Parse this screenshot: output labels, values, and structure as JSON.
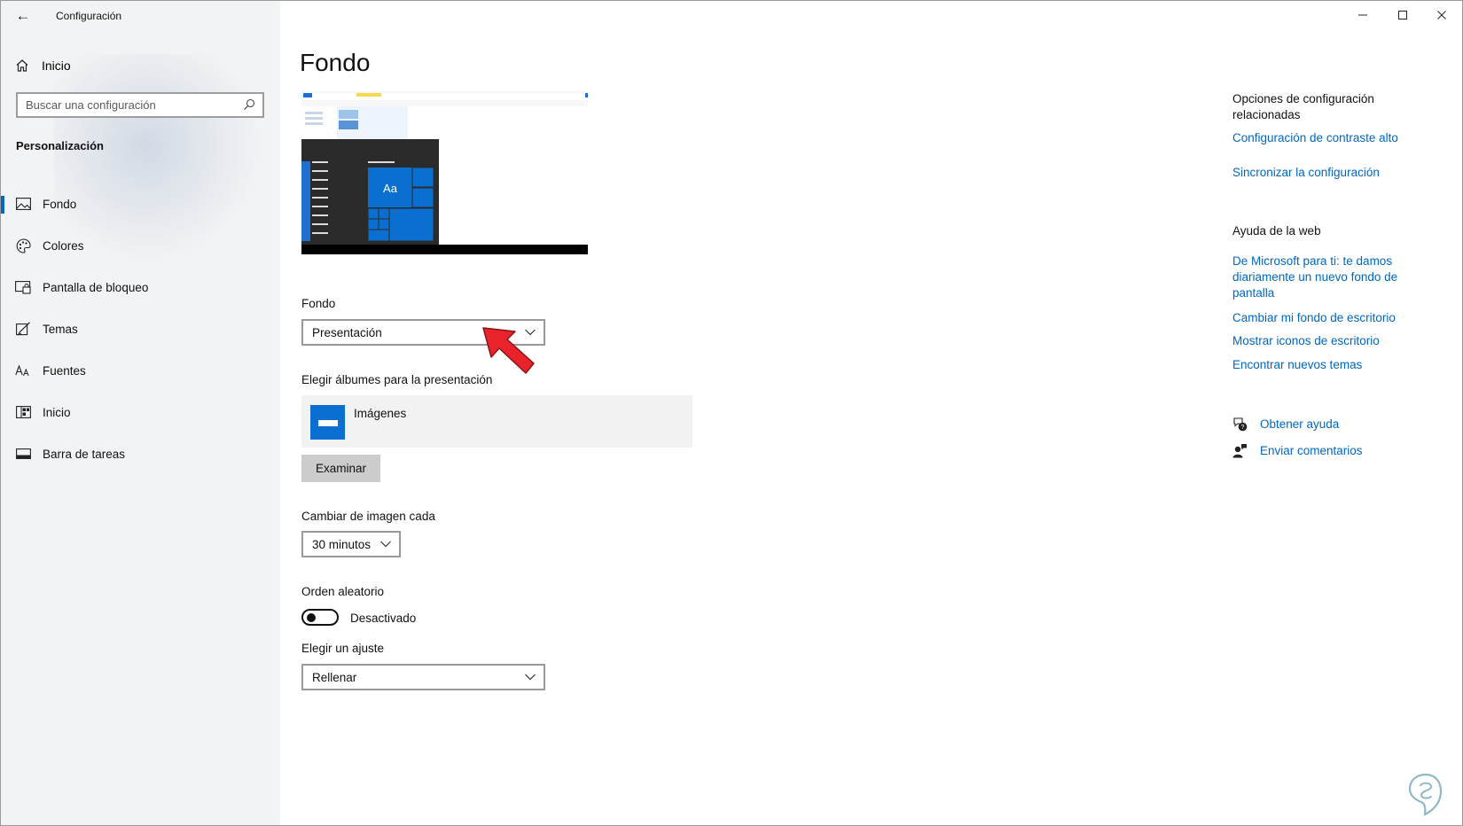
{
  "window": {
    "title": "Configuración",
    "controls": [
      "minimize-icon",
      "maximize-icon",
      "close-icon"
    ]
  },
  "sidebar": {
    "home_label": "Inicio",
    "search_placeholder": "Buscar una configuración",
    "section_title": "Personalización",
    "items": [
      {
        "label": "Fondo",
        "icon": "picture-icon",
        "active": true
      },
      {
        "label": "Colores",
        "icon": "palette-icon",
        "active": false
      },
      {
        "label": "Pantalla de bloqueo",
        "icon": "lock-screen-icon",
        "active": false
      },
      {
        "label": "Temas",
        "icon": "brush-icon",
        "active": false
      },
      {
        "label": "Fuentes",
        "icon": "font-icon",
        "active": false
      },
      {
        "label": "Inicio",
        "icon": "start-icon",
        "active": false
      },
      {
        "label": "Barra de tareas",
        "icon": "taskbar-icon",
        "active": false
      }
    ]
  },
  "main": {
    "title": "Fondo",
    "preview_tile_text": "Aa",
    "background_label": "Fondo",
    "background_value": "Presentación",
    "albums_label": "Elegir álbumes para la presentación",
    "album_name": "Imágenes",
    "browse_label": "Examinar",
    "interval_label": "Cambiar de imagen cada",
    "interval_value": "30 minutos",
    "shuffle_label": "Orden aleatorio",
    "shuffle_state": "Desactivado",
    "fit_label": "Elegir un ajuste",
    "fit_value": "Rellenar"
  },
  "related": {
    "title": "Opciones de configuración relacionadas",
    "links": [
      "Configuración de contraste alto",
      "Sincronizar la configuración"
    ]
  },
  "web_help": {
    "title": "Ayuda de la web",
    "links": [
      "De Microsoft para ti: te damos diariamente un nuevo fondo de pantalla",
      "Cambiar mi fondo de escritorio",
      "Mostrar iconos de escritorio",
      "Encontrar nuevos temas"
    ]
  },
  "help": {
    "get_help": "Obtener ayuda",
    "feedback": "Enviar comentarios"
  },
  "colors": {
    "accent": "#0067c0",
    "tile_blue": "#0a6fd1",
    "pointer_red": "#e8232a"
  }
}
